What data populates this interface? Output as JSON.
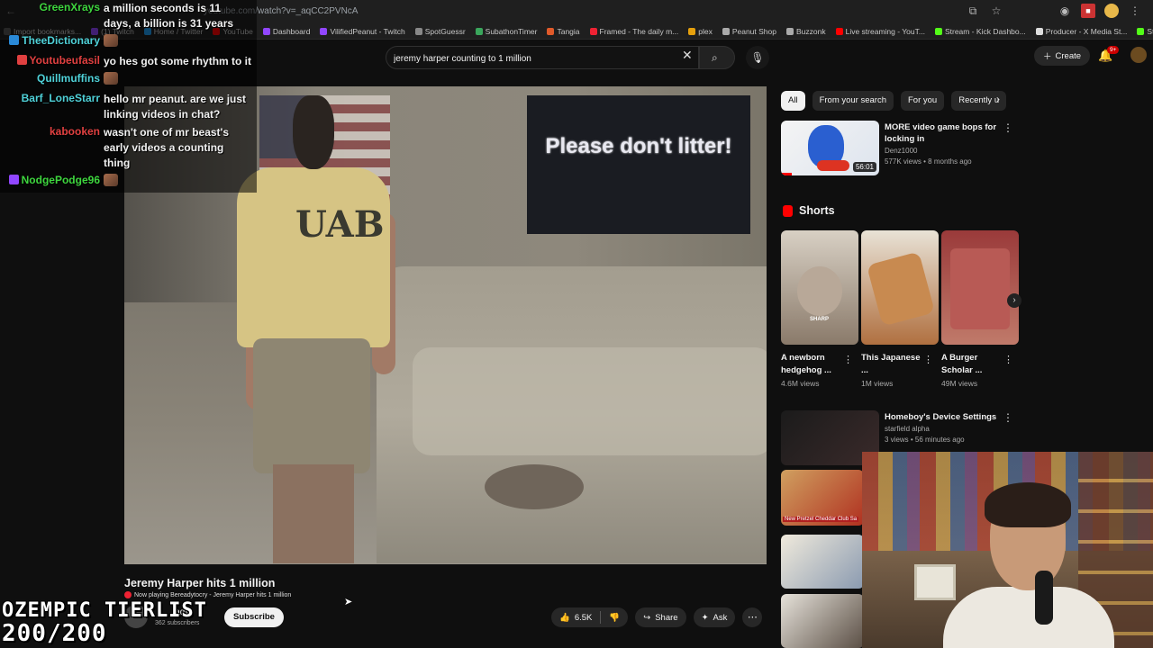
{
  "browser": {
    "url": "youtube.com/watch?v=_aqCC2PVNcA",
    "bookmarks": [
      {
        "label": "Import bookmarks...",
        "color": "#555"
      },
      {
        "label": "(1) Twitch",
        "color": "#9146ff"
      },
      {
        "label": "Home / Twitter",
        "color": "#1d9bf0"
      },
      {
        "label": "YouTube",
        "color": "#ff0000"
      },
      {
        "label": "Dashboard",
        "color": "#9146ff"
      },
      {
        "label": "VilifiedPeanut - Twitch",
        "color": "#9146ff"
      },
      {
        "label": "SpotGuessr",
        "color": "#888"
      },
      {
        "label": "SubathonTimer",
        "color": "#3aa65c"
      },
      {
        "label": "Tangia",
        "color": "#e05a2a"
      },
      {
        "label": "Framed - The daily m...",
        "color": "#e23"
      },
      {
        "label": "plex",
        "color": "#e5a00d"
      },
      {
        "label": "Peanut Shop",
        "color": "#aaa"
      },
      {
        "label": "Buzzonk",
        "color": "#aaa"
      },
      {
        "label": "Live streaming - YouT...",
        "color": "#ff0000"
      },
      {
        "label": "Stream - Kick Dashbo...",
        "color": "#53fc18"
      },
      {
        "label": "Producer - X Media St...",
        "color": "#ddd"
      },
      {
        "label": "Stream - Kick Dashbo...",
        "color": "#53fc18"
      }
    ]
  },
  "youtube": {
    "search_query": "jeremy harper counting to 1 million",
    "create_label": "Create",
    "notification_badge": "9+",
    "video_overlay_text": "Please don't litter!",
    "video_shirt_text": "UAB",
    "video_title": "Jeremy Harper hits 1 million",
    "now_playing": "Now playing Bereadytocry - Jeremy Harper hits 1 million",
    "channel_name": "lady",
    "subscribers": "362 subscribers",
    "subscribe_label": "Subscribe",
    "likes": "6.5K",
    "share_label": "Share",
    "ask_label": "Ask",
    "chips": [
      "All",
      "From your search",
      "For you",
      "Recently u"
    ],
    "rec1": {
      "title": "MORE video game bops for locking in",
      "channel": "Denz1000",
      "meta": "577K views • 8 months ago",
      "duration": "56:01"
    },
    "shorts_heading": "Shorts",
    "shorts": [
      {
        "title": "A newborn hedgehog ...",
        "views": "4.6M views",
        "caption": "SHARP"
      },
      {
        "title": "This Japanese ...",
        "views": "1M views",
        "caption": ""
      },
      {
        "title": "A Burger Scholar ...",
        "views": "49M views",
        "caption": ""
      }
    ],
    "rec2": {
      "title": "Homeboy's Device Settings",
      "channel": "starfield alpha",
      "meta": "3 views • 56 minutes ago"
    },
    "rec3_label": "New Pretzel Cheddar Club Sa"
  },
  "chat": [
    {
      "user": "GreenXrays",
      "color": "#3ed63e",
      "text": "a million seconds is 11 days, a billion is 31 years",
      "badge": ""
    },
    {
      "user": "TheeDictionary",
      "color": "#4fd1d8",
      "text": "",
      "badge": "#2a8ad8",
      "emote": true
    },
    {
      "user": "Youtubeufasil",
      "color": "#e04040",
      "text": "yo hes got some rhythm to it",
      "badge": "#e04040"
    },
    {
      "user": "Quillmuffins",
      "color": "#4fd1d8",
      "text": "",
      "badge": "",
      "emote": true
    },
    {
      "user": "Barf_LoneStarr",
      "color": "#4fd1d8",
      "text": "hello mr peanut. are we just linking videos in chat?",
      "badge": ""
    },
    {
      "user": "kabooken",
      "color": "#e04040",
      "text": "wasn't one of mr beast's early videos a counting thing",
      "badge": ""
    },
    {
      "user": "NodgePodge96",
      "color": "#3ed63e",
      "text": "",
      "badge": "#9146ff",
      "emote": true
    }
  ],
  "overlay": {
    "label": "OZEMPIC TIERLIST",
    "counter": "200/200"
  },
  "colors": {
    "background": "#0f0f0f",
    "accent": "#ff0000"
  }
}
